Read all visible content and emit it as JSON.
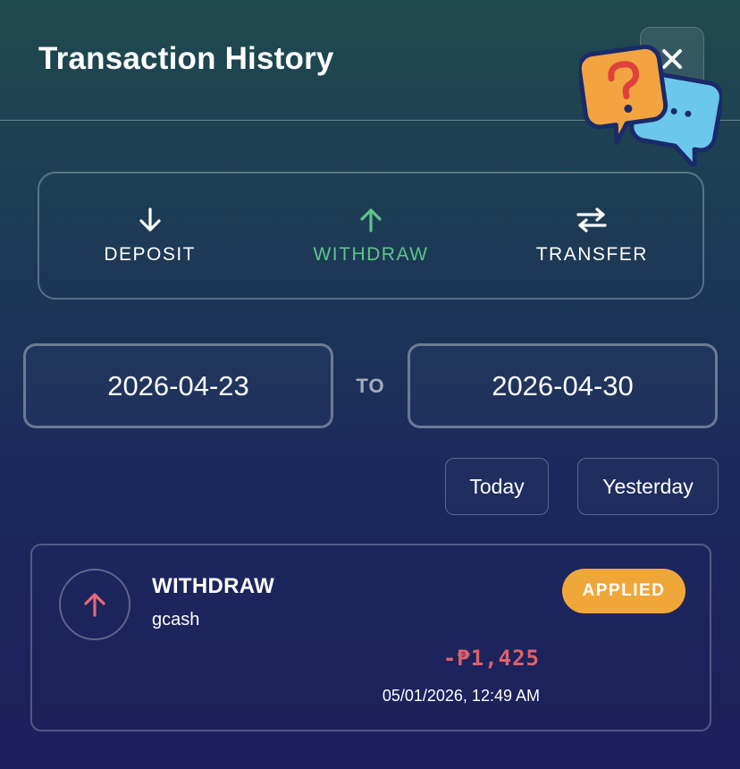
{
  "header": {
    "title": "Transaction History",
    "close_icon": "close-icon",
    "help_icon": "chat-help-icon"
  },
  "tabs": [
    {
      "label": "DEPOSIT",
      "icon": "arrow-down-icon",
      "active": false
    },
    {
      "label": "WITHDRAW",
      "icon": "arrow-up-icon",
      "active": true
    },
    {
      "label": "TRANSFER",
      "icon": "swap-arrows-icon",
      "active": false
    }
  ],
  "date_range": {
    "from": "2026-04-23",
    "separator": "TO",
    "to": "2026-04-30"
  },
  "quick_filters": {
    "today": "Today",
    "yesterday": "Yesterday"
  },
  "transactions": [
    {
      "type": "WITHDRAW",
      "method": "gcash",
      "status": "APPLIED",
      "amount": "-₱1,425",
      "datetime": "05/01/2026, 12:49 AM"
    }
  ],
  "colors": {
    "active_tab": "#5ec38a",
    "status_badge": "#f0a73a",
    "amount_negative": "#e0606a",
    "withdraw_icon": "#e8687a"
  }
}
